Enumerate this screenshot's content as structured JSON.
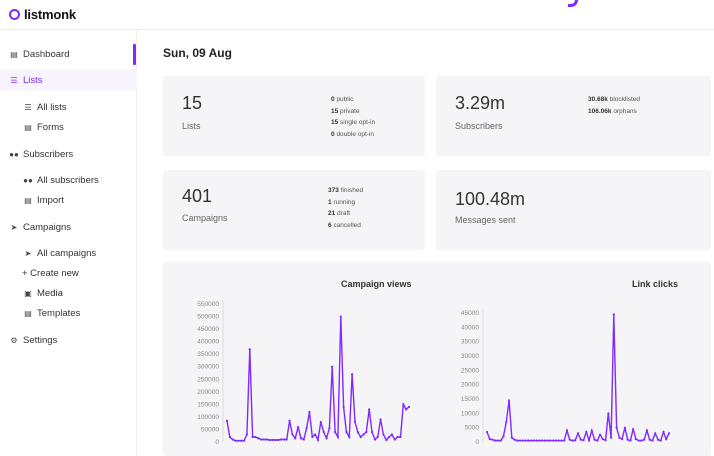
{
  "app": {
    "name": "listmonk"
  },
  "nav": {
    "dashboard": "Dashboard",
    "lists": "Lists",
    "all_lists": "All lists",
    "forms": "Forms",
    "subscribers": "Subscribers",
    "all_subscribers": "All subscribers",
    "import": "Import",
    "campaigns": "Campaigns",
    "all_campaigns": "All campaigns",
    "create_new": "+ Create new",
    "media": "Media",
    "templates": "Templates",
    "settings": "Settings"
  },
  "header": {
    "date": "Sun, 09 Aug"
  },
  "cards": {
    "lists": {
      "count": "15",
      "label": "Lists",
      "stats": [
        {
          "value": "0",
          "label": "public"
        },
        {
          "value": "15",
          "label": "private"
        },
        {
          "value": "15",
          "label": "single opt-in"
        },
        {
          "value": "0",
          "label": "double opt-in"
        }
      ]
    },
    "subscribers": {
      "count": "3.29m",
      "label": "Subscribers",
      "stats": [
        {
          "value": "30.68k",
          "label": "blocklisted"
        },
        {
          "value": "106.06k",
          "label": "orphans"
        }
      ]
    },
    "campaigns": {
      "count": "401",
      "label": "Campaigns",
      "stats": [
        {
          "value": "373",
          "label": "finished"
        },
        {
          "value": "1",
          "label": "running"
        },
        {
          "value": "21",
          "label": "draft"
        },
        {
          "value": "6",
          "label": "cancelled"
        }
      ]
    },
    "messages": {
      "count": "100.48m",
      "label": "Messages sent"
    }
  },
  "chart_data": [
    {
      "type": "line",
      "title": "Campaign views",
      "ylim": [
        0,
        550000
      ],
      "yticks": [
        "0",
        "50000",
        "100000",
        "150000",
        "200000",
        "250000",
        "300000",
        "350000",
        "400000",
        "450000",
        "500000",
        "550000"
      ],
      "values": [
        85000,
        20000,
        10000,
        5000,
        5000,
        5000,
        5000,
        30000,
        370000,
        20000,
        20000,
        15000,
        10000,
        10000,
        10000,
        8000,
        8000,
        8000,
        8000,
        10000,
        10000,
        10000,
        85000,
        30000,
        15000,
        60000,
        15000,
        10000,
        55000,
        120000,
        20000,
        30000,
        8000,
        80000,
        40000,
        15000,
        55000,
        300000,
        40000,
        20000,
        500000,
        140000,
        40000,
        20000,
        270000,
        80000,
        40000,
        20000,
        30000,
        40000,
        130000,
        40000,
        10000,
        20000,
        90000,
        30000,
        8000,
        20000,
        30000,
        10000,
        20000,
        20000,
        150000,
        130000,
        140000
      ],
      "color": "#7f2aff"
    },
    {
      "type": "line",
      "title": "Link clicks",
      "ylim": [
        0,
        45000
      ],
      "yticks": [
        "0",
        "5000",
        "10000",
        "15000",
        "20000",
        "25000",
        "30000",
        "35000",
        "40000",
        "45000"
      ],
      "values": [
        3500,
        1000,
        800,
        500,
        500,
        500,
        2000,
        7000,
        14500,
        1500,
        800,
        500,
        500,
        500,
        500,
        500,
        500,
        500,
        500,
        500,
        500,
        500,
        500,
        500,
        500,
        500,
        500,
        500,
        500,
        4000,
        800,
        500,
        600,
        3000,
        800,
        600,
        3500,
        600,
        4000,
        800,
        500,
        2500,
        1000,
        600,
        10000,
        1500,
        44500,
        5000,
        1500,
        1000,
        5000,
        800,
        500,
        4500,
        1000,
        500,
        500,
        800,
        4000,
        800,
        500,
        3000,
        800,
        500,
        3500,
        1000,
        3000
      ]
    }
  ]
}
